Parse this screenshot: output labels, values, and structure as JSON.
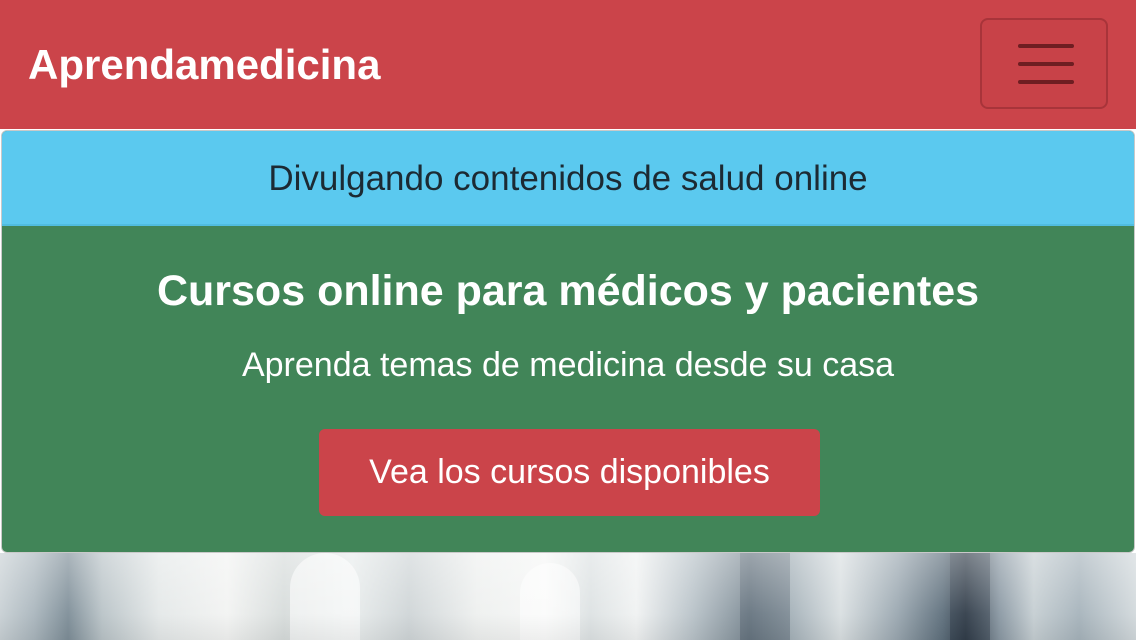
{
  "navbar": {
    "brand": "Aprendamedicina",
    "menu_toggle_icon": "hamburger-menu-icon",
    "background_color": "#cb444a"
  },
  "card": {
    "header": "Divulgando contenidos de salud online",
    "header_color": "#5bc9ef",
    "body_color": "#418558",
    "title": "Cursos online para médicos y pacientes",
    "text": "Aprenda temas de medicina desde su casa",
    "button_label": "Vea los cursos disponibles",
    "button_color": "#cb444a"
  },
  "hero_image": {
    "description_icon": "blurred-hospital-photo"
  }
}
